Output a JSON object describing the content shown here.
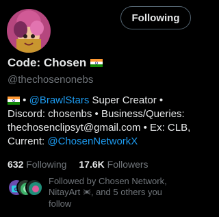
{
  "profile": {
    "display_name": "Code: Chosen",
    "handle": "@thechosenonebs"
  },
  "follow_button": {
    "label": "Following"
  },
  "bio": {
    "part1": " • ",
    "mention1": "@BrawlStars",
    "part2": " Super Creator • Discord: chosenbs • Business/Queries: thechosenclipsyt@gmail.com • Ex: CLB, Current: ",
    "mention2": "@ChosenNetworkX"
  },
  "stats": {
    "following_count": "632",
    "following_label": "Following",
    "followers_count": "17.6K",
    "followers_label": "Followers"
  },
  "followed_by": {
    "text_before": "Followed by Chosen Network, NitayArt ",
    "text_after": ", and 5 others you follow"
  },
  "colors": {
    "background": "#000000",
    "text": "#e7e9ea",
    "muted": "#71767b",
    "link": "#1d9bf0",
    "button_border": "#536471"
  },
  "icons": {
    "flag": "india-flag-icon",
    "spider": "spider-icon"
  }
}
